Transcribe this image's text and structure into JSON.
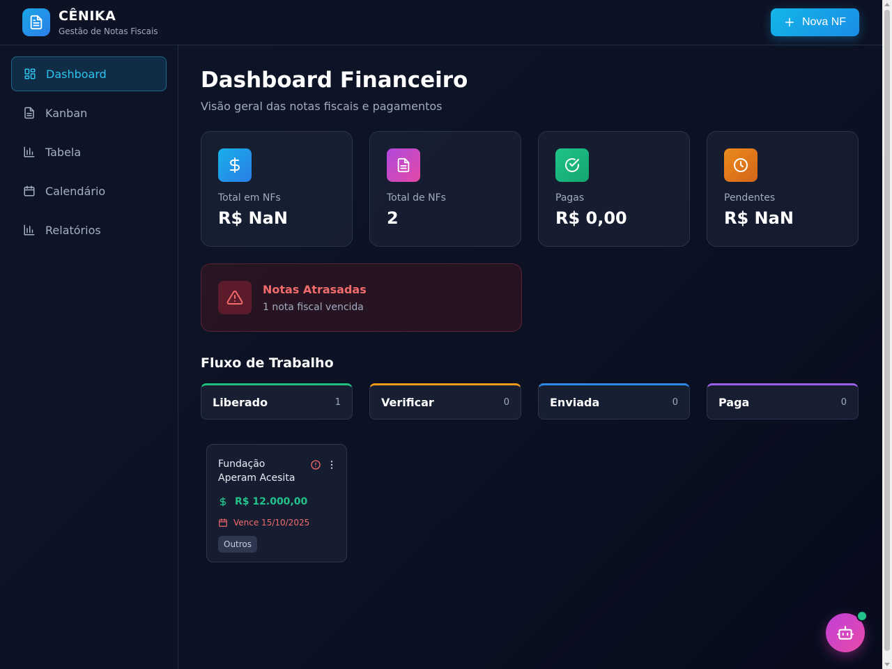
{
  "app": {
    "title": "CÊNIKA",
    "subtitle": "Gestão de Notas Fiscais",
    "logo_icon": "document-icon",
    "new_button": "Nova NF"
  },
  "sidebar": {
    "items": [
      {
        "label": "Dashboard",
        "icon": "dashboard-icon",
        "active": true
      },
      {
        "label": "Kanban",
        "icon": "document-icon",
        "active": false
      },
      {
        "label": "Tabela",
        "icon": "bar-chart-icon",
        "active": false
      },
      {
        "label": "Calendário",
        "icon": "calendar-icon",
        "active": false
      },
      {
        "label": "Relatórios",
        "icon": "bar-chart-icon",
        "active": false
      }
    ]
  },
  "main": {
    "title": "Dashboard Financeiro",
    "subtitle": "Visão geral das notas fiscais e pagamentos",
    "stats": [
      {
        "label": "Total em NFs",
        "value": "R$ NaN",
        "icon": "dollar-icon",
        "color": "#1aa6e6"
      },
      {
        "label": "Total de NFs",
        "value": "2",
        "icon": "document-icon",
        "color": "#c04fd8"
      },
      {
        "label": "Pagas",
        "value": "R$ 0,00",
        "icon": "check-circle-icon",
        "color": "#1fbf7f"
      },
      {
        "label": "Pendentes",
        "value": "R$ NaN",
        "icon": "clock-icon",
        "color": "#e0791a"
      }
    ],
    "alert": {
      "title": "Notas Atrasadas",
      "subtitle": "1 nota fiscal vencida",
      "icon": "warning-icon"
    },
    "workflow": {
      "title": "Fluxo de Trabalho",
      "columns": [
        {
          "name": "Liberado",
          "count": "1",
          "color": "#1fbf7f"
        },
        {
          "name": "Verificar",
          "count": "0",
          "color": "#f29a1a"
        },
        {
          "name": "Enviada",
          "count": "0",
          "color": "#2e8ae8"
        },
        {
          "name": "Paga",
          "count": "0",
          "color": "#9a5ee8"
        }
      ],
      "card": {
        "company": "Fundação Aperam Acesita",
        "amount": "R$ 12.000,00",
        "due": "Vence 15/10/2025",
        "tag": "Outros"
      }
    }
  },
  "assistant": {
    "icon": "bot-icon",
    "status_color": "#22c38a"
  }
}
